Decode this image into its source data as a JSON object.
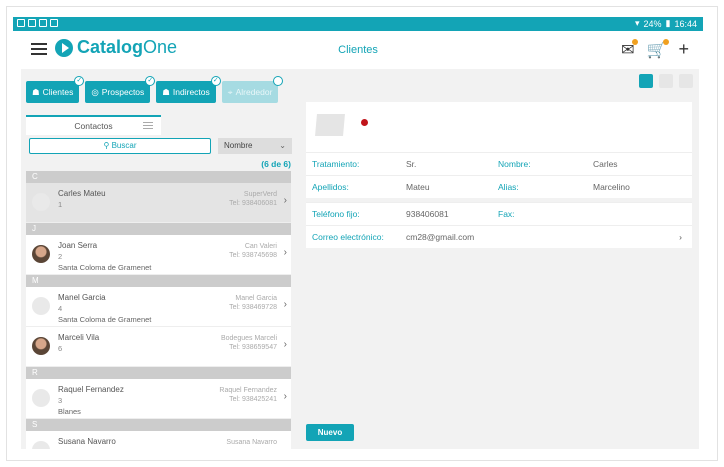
{
  "status": {
    "battery": "24%",
    "time": "16:44"
  },
  "app": {
    "brand_main": "Catalog",
    "brand_suffix": "One",
    "title": "Clientes"
  },
  "tabs": [
    {
      "label": "Clientes",
      "icon": "users-icon"
    },
    {
      "label": "Prospectos",
      "icon": "target-icon"
    },
    {
      "label": "Indirectos",
      "icon": "users-icon"
    },
    {
      "label": "Alrededor",
      "icon": "location-icon"
    }
  ],
  "left": {
    "header": "Contactos",
    "search_placeholder": "Buscar",
    "sort_value": "Nombre",
    "count": "(6 de 6)",
    "sections": [
      {
        "letter": "C",
        "rows": [
          {
            "name": "Carles Mateu",
            "num": "1",
            "city": "",
            "company": "SuperVerd",
            "tel": "Tel: 938406081",
            "selected": true,
            "photo": false
          }
        ]
      },
      {
        "letter": "J",
        "rows": [
          {
            "name": "Joan Serra",
            "num": "2",
            "city": "Santa Coloma de Gramenet",
            "company": "Can Valeri",
            "tel": "Tel: 938745698",
            "selected": false,
            "photo": true
          }
        ]
      },
      {
        "letter": "M",
        "rows": [
          {
            "name": "Manel Garcia",
            "num": "4",
            "city": "Santa Coloma de Gramenet",
            "company": "Manel Garcia",
            "tel": "Tel: 938469728",
            "selected": false,
            "photo": false
          },
          {
            "name": "Marceli Vila",
            "num": "6",
            "city": "",
            "company": "Bodegues Marceli",
            "tel": "Tel: 938659547",
            "selected": false,
            "photo": true
          }
        ]
      },
      {
        "letter": "R",
        "rows": [
          {
            "name": "Raquel Fernandez",
            "num": "3",
            "city": "Blanes",
            "company": "Raquel Fernandez",
            "tel": "Tel: 938425241",
            "selected": false,
            "photo": false
          }
        ]
      },
      {
        "letter": "S",
        "rows": [
          {
            "name": "Susana Navarro",
            "num": "",
            "city": "",
            "company": "Susana Navarro",
            "tel": "",
            "selected": false,
            "photo": false
          }
        ]
      }
    ]
  },
  "detail": {
    "tratamiento_label": "Tratamiento:",
    "tratamiento": "Sr.",
    "nombre_label": "Nombre:",
    "nombre": "Carles",
    "apellidos_label": "Apellidos:",
    "apellidos": "Mateu",
    "alias_label": "Alias:",
    "alias": "Marcelino",
    "telefono_label": "Teléfono fijo:",
    "telefono": "938406081",
    "fax_label": "Fax:",
    "fax": "",
    "email_label": "Correo electrónico:",
    "email": "cm28@gmail.com",
    "nuevo_label": "Nuevo"
  }
}
